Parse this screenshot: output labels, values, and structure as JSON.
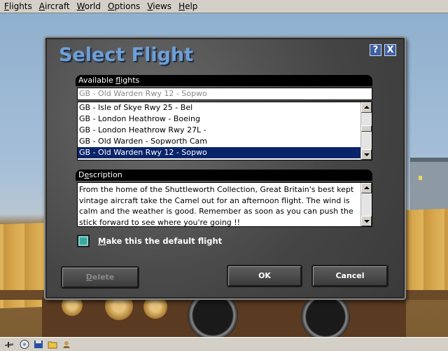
{
  "menubar": {
    "items": [
      {
        "label": "Flights",
        "mnemonic": "F",
        "rest": "lights"
      },
      {
        "label": "Aircraft",
        "mnemonic": "A",
        "rest": "ircraft"
      },
      {
        "label": "World",
        "mnemonic": "W",
        "rest": "orld"
      },
      {
        "label": "Options",
        "mnemonic": "O",
        "rest": "ptions"
      },
      {
        "label": "Views",
        "mnemonic": "V",
        "rest": "iews"
      },
      {
        "label": "Help",
        "mnemonic": "H",
        "rest": "elp"
      }
    ]
  },
  "dialog": {
    "title": "Select Flight",
    "help_label": "?",
    "close_label": "X",
    "available_section": {
      "prefix": "Available ",
      "mnemonic": "f",
      "suffix": "lights"
    },
    "combo_value": "GB - Old Warden Rwy 12 - Sopwo",
    "flights": [
      {
        "label": "GB - Isle of Skye Rwy 25 - Bel",
        "selected": false
      },
      {
        "label": "GB - London Heathrow - Boeing",
        "selected": false
      },
      {
        "label": "GB - London Heathrow Rwy 27L -",
        "selected": false
      },
      {
        "label": "GB - Old Warden - Sopworth Cam",
        "selected": false
      },
      {
        "label": "GB - Old Warden Rwy 12 - Sopwo",
        "selected": true
      }
    ],
    "description_section": {
      "prefix": "D",
      "mnemonic": "e",
      "suffix": "scription"
    },
    "description": "From the home of the Shuttleworth Collection, Great Britain's best kept vintage aircraft take the Camel out for an afternoon flight. The wind is calm and the weather is good. Remember as soon as you can push the stick forward to see where you're going !!",
    "default_checkbox": {
      "mnemonic": "M",
      "rest": "ake this the default flight"
    },
    "delete_button": {
      "mnemonic": "D",
      "rest": "elete"
    },
    "ok_label": "OK",
    "cancel_label": "Cancel"
  },
  "colors": {
    "title": "#6f9fd6",
    "selection": "#0a246a",
    "checkbox": "#3aa7a0"
  },
  "icons": [
    "toolbar-aircraft-icon",
    "toolbar-disc-icon",
    "toolbar-save-icon",
    "toolbar-folder-icon",
    "toolbar-pilot-icon"
  ]
}
